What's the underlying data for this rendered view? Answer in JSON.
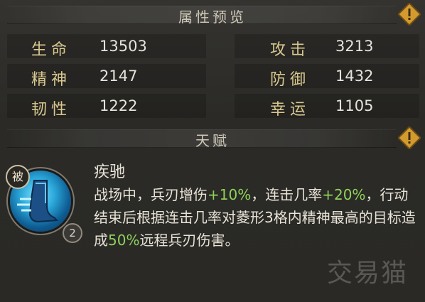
{
  "attributes_header": {
    "title": "属性预览"
  },
  "stats": [
    {
      "label": "生命",
      "value": "13503"
    },
    {
      "label": "攻击",
      "value": "3213"
    },
    {
      "label": "精神",
      "value": "2147"
    },
    {
      "label": "防御",
      "value": "1432"
    },
    {
      "label": "韧性",
      "value": "1222"
    },
    {
      "label": "幸运",
      "value": "1105"
    }
  ],
  "talent_header": {
    "title": "天赋"
  },
  "talent": {
    "badge_passive": "被",
    "level": "2",
    "name": "疾驰",
    "desc": {
      "p1": "战场中，兵刃增伤",
      "v1": "+10%",
      "p2": "，连击几率",
      "v2": "+20%",
      "p3": "，行动结束后根据连击几率对菱形3格内精神最高的目标造成",
      "v3": "50%",
      "p4": "远程兵刃伤害。"
    }
  },
  "watermark": "交易猫",
  "colors": {
    "highlight": "#8fd25a",
    "label_gold": "#d9c98f",
    "warn_orange": "#d39a2e"
  }
}
